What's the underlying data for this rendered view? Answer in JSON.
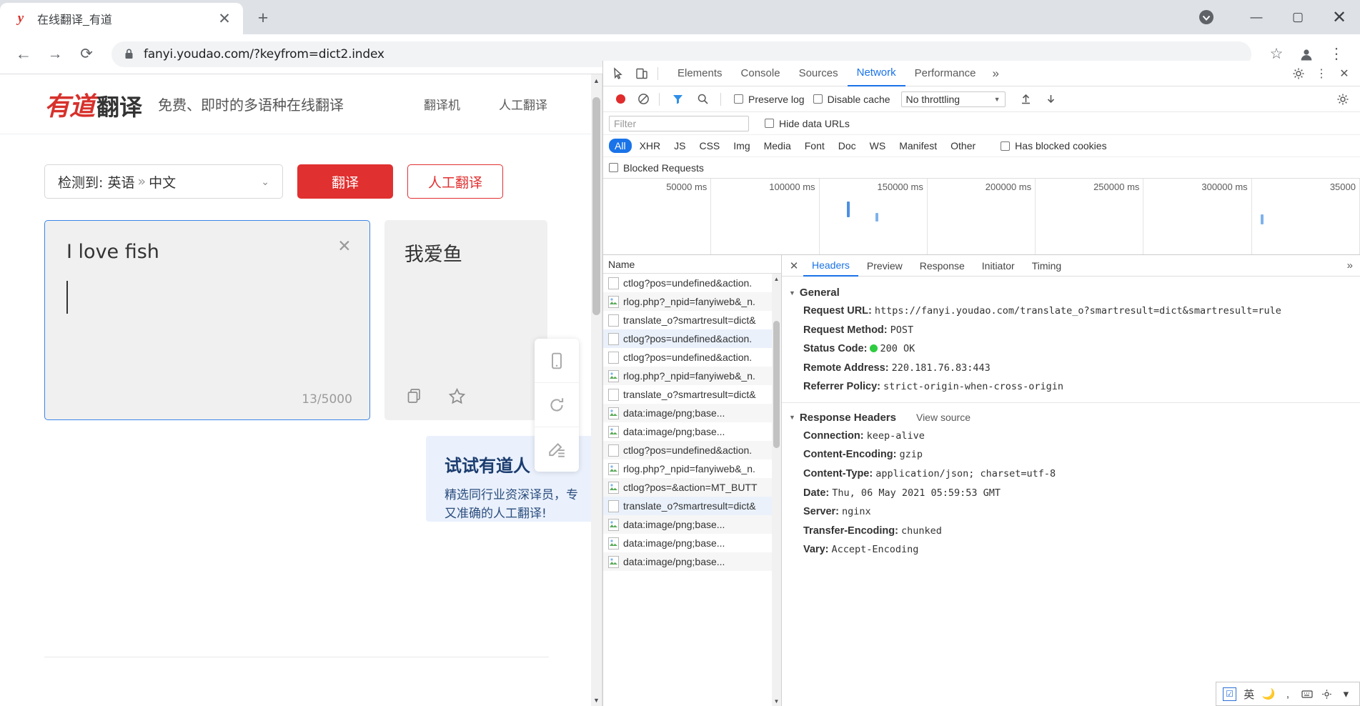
{
  "browser": {
    "tab": {
      "title": "在线翻译_有道",
      "favicon": "youdao-y-icon",
      "close": "✕"
    },
    "new_tab": "+",
    "window_controls": {
      "minimize": "—",
      "maximize": "▢",
      "close": "✕",
      "shield": "shield-icon"
    },
    "toolbar": {
      "back": "←",
      "forward": "→",
      "reload": "⟳",
      "lock": "lock-icon",
      "url": "fanyi.youdao.com/?keyfrom=dict2.index",
      "bookmark": "☆",
      "profile": "profile-icon",
      "menu": "⋮"
    }
  },
  "site": {
    "logo_main": "有道",
    "logo_sub": "翻译",
    "slogan": "免费、即时的多语种在线翻译",
    "header_links": [
      "翻译机",
      "人工翻译"
    ],
    "lang_from": "检测到: 英语",
    "lang_sep": "»",
    "lang_to": "中文",
    "chevron": "⌄",
    "btn_translate": "翻译",
    "btn_human": "人工翻译",
    "input_text": "I love fish",
    "input_clear": "✕",
    "counter": "13/5000",
    "output_text": "我爱鱼",
    "output_actions": [
      "copy-icon",
      "star-icon"
    ],
    "promo_title": "试试有道人",
    "promo_body": "精选同行业资深译员，专\n又准确的人工翻译!",
    "side_tools": [
      "mobile-icon",
      "refresh-icon",
      "feedback-icon"
    ]
  },
  "devtools": {
    "inspect_icon": "inspect-icon",
    "device_icon": "device-toolbar-icon",
    "tabs": [
      "Elements",
      "Console",
      "Sources",
      "Network",
      "Performance"
    ],
    "active_tab": "Network",
    "more_tabs": "»",
    "settings_icon": "gear-icon",
    "kebab_icon": "⋮",
    "close_icon": "✕",
    "network_toolbar": {
      "record": "record-icon",
      "clear": "clear-icon",
      "filter": "filter-icon",
      "search": "search-icon",
      "preserve_log": "Preserve log",
      "disable_cache": "Disable cache",
      "throttling": "No throttling",
      "import": "import-icon",
      "export": "export-icon",
      "settings": "gear-icon"
    },
    "filter_placeholder": "Filter",
    "hide_data_urls": "Hide data URLs",
    "types": [
      "All",
      "XHR",
      "JS",
      "CSS",
      "Img",
      "Media",
      "Font",
      "Doc",
      "WS",
      "Manifest",
      "Other"
    ],
    "active_type": "All",
    "has_blocked_cookies": "Has blocked cookies",
    "blocked_requests": "Blocked Requests",
    "overview_ticks": [
      "50000 ms",
      "100000 ms",
      "150000 ms",
      "200000 ms",
      "250000 ms",
      "300000 ms",
      "35000"
    ],
    "name_column": "Name",
    "requests": [
      {
        "name": "data:image/png;base...",
        "icon": "image-icon",
        "selected": false
      },
      {
        "name": "data:image/png;base...",
        "icon": "image-icon",
        "selected": false
      },
      {
        "name": "data:image/png;base...",
        "icon": "image-icon",
        "selected": false
      },
      {
        "name": "translate_o?smartresult=dict&",
        "icon": "doc-icon",
        "selected": true
      },
      {
        "name": "ctlog?pos=&action=MT_BUTT",
        "icon": "image-icon",
        "selected": false
      },
      {
        "name": "rlog.php?_npid=fanyiweb&_n.",
        "icon": "image-icon",
        "selected": false
      },
      {
        "name": "ctlog?pos=undefined&action.",
        "icon": "doc-icon",
        "selected": false
      },
      {
        "name": "data:image/png;base...",
        "icon": "image-icon",
        "selected": false
      },
      {
        "name": "data:image/png;base...",
        "icon": "image-icon",
        "selected": false
      },
      {
        "name": "translate_o?smartresult=dict&",
        "icon": "doc-icon",
        "selected": false
      },
      {
        "name": "rlog.php?_npid=fanyiweb&_n.",
        "icon": "image-icon",
        "selected": false
      },
      {
        "name": "ctlog?pos=undefined&action.",
        "icon": "doc-icon",
        "selected": false
      },
      {
        "name": "ctlog?pos=undefined&action.",
        "icon": "doc-icon",
        "selected": true
      },
      {
        "name": "translate_o?smartresult=dict&",
        "icon": "doc-icon",
        "selected": false
      },
      {
        "name": "rlog.php?_npid=fanyiweb&_n.",
        "icon": "image-icon",
        "selected": false
      },
      {
        "name": "ctlog?pos=undefined&action.",
        "icon": "doc-icon",
        "selected": false
      }
    ],
    "detail_tabs": [
      "Headers",
      "Preview",
      "Response",
      "Initiator",
      "Timing"
    ],
    "detail_active": "Headers",
    "detail_more": "»",
    "general_title": "General",
    "general": [
      {
        "key": "Request URL:",
        "value": "https://fanyi.youdao.com/translate_o?smartresult=dict&smartresult=rule"
      },
      {
        "key": "Request Method:",
        "value": "POST"
      },
      {
        "key": "Status Code:",
        "value": "200 OK",
        "status": true
      },
      {
        "key": "Remote Address:",
        "value": "220.181.76.83:443"
      },
      {
        "key": "Referrer Policy:",
        "value": "strict-origin-when-cross-origin"
      }
    ],
    "response_title": "Response Headers",
    "view_source": "View source",
    "response_headers": [
      {
        "key": "Connection:",
        "value": "keep-alive"
      },
      {
        "key": "Content-Encoding:",
        "value": "gzip"
      },
      {
        "key": "Content-Type:",
        "value": "application/json; charset=utf-8"
      },
      {
        "key": "Date:",
        "value": "Thu, 06 May 2021 05:59:53 GMT"
      },
      {
        "key": "Server:",
        "value": "nginx"
      },
      {
        "key": "Transfer-Encoding:",
        "value": "chunked"
      },
      {
        "key": "Vary:",
        "value": "Accept-Encoding"
      }
    ]
  },
  "ime": {
    "lang": "英",
    "items": [
      "checkbox-icon",
      "lang-icon",
      "moon-icon",
      "punct-icon",
      "keyboard-icon",
      "gear-icon",
      "arrow-icon"
    ]
  }
}
